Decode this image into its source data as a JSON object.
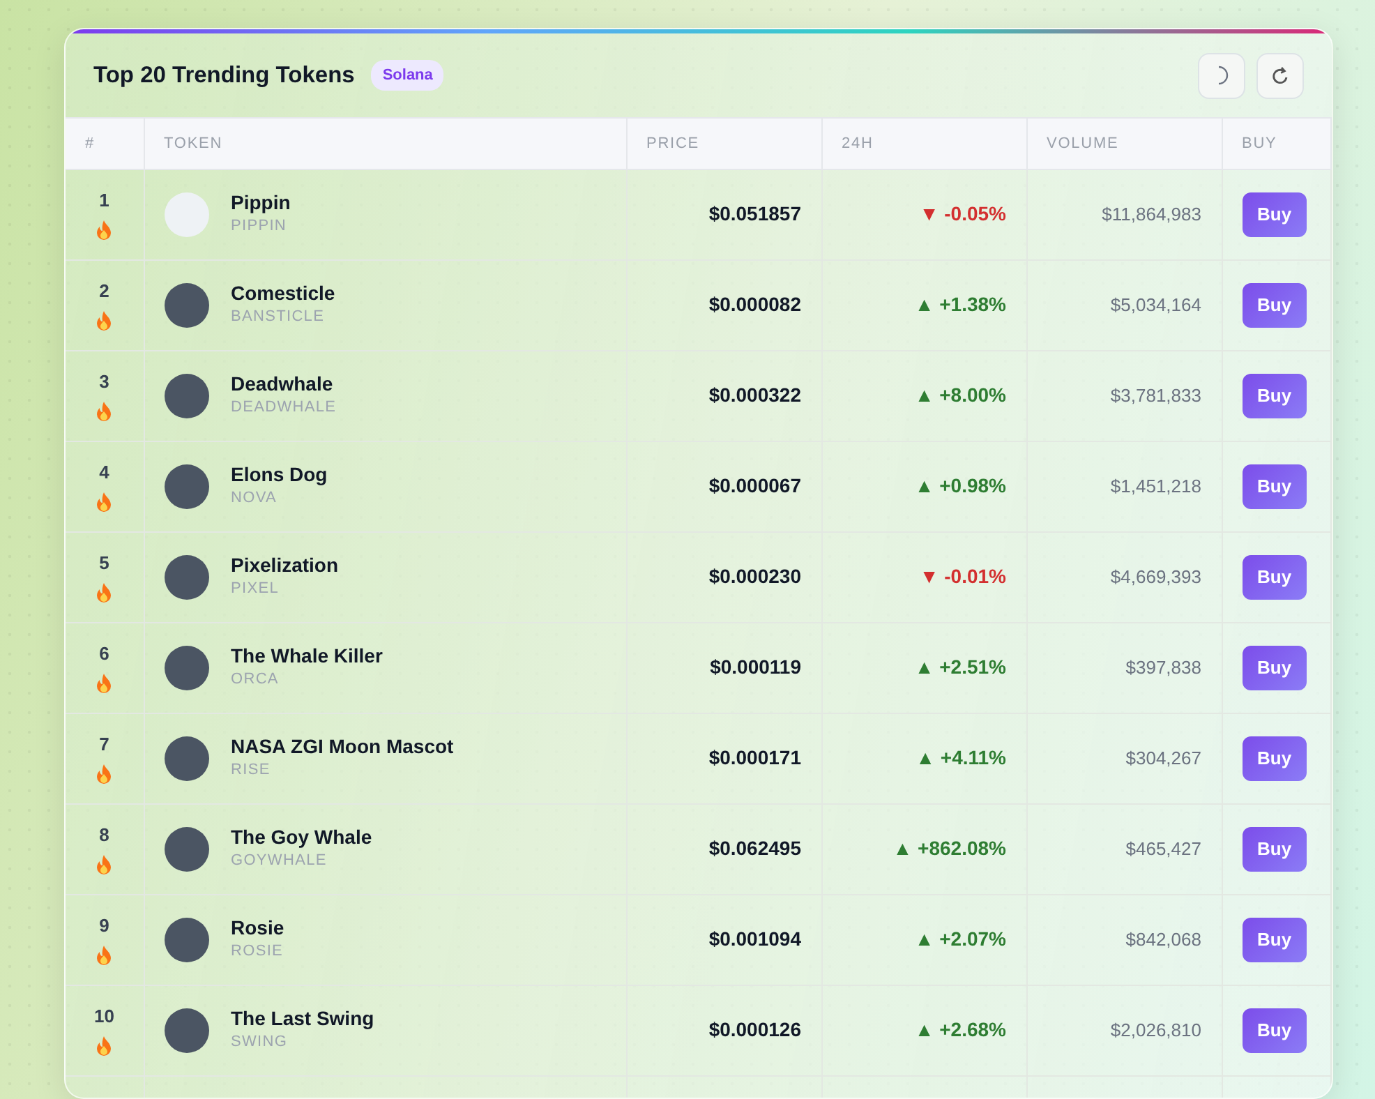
{
  "header": {
    "title": "Top 20 Trending Tokens",
    "chain_badge": "Solana"
  },
  "table": {
    "columns": [
      "#",
      "TOKEN",
      "PRICE",
      "24H",
      "VOLUME",
      "BUY"
    ],
    "rows": [
      {
        "rank": "1",
        "name": "Pippin",
        "symbol": "PIPPIN",
        "price": "$0.051857",
        "change": "▼ -0.05%",
        "color": "#d32f2f",
        "volume": "$11,864,983",
        "button": "Buy"
      },
      {
        "rank": "2",
        "name": "Comesticle",
        "symbol": "BANSTICLE",
        "price": "$0.000082",
        "change": "▲ +1.38%",
        "color": "#2e7d32",
        "volume": "$5,034,164",
        "button": "Buy"
      },
      {
        "rank": "3",
        "name": "Deadwhale",
        "symbol": "DEADWHALE",
        "price": "$0.000322",
        "change": "▲ +8.00%",
        "color": "#2e7d32",
        "volume": "$3,781,833",
        "button": "Buy"
      },
      {
        "rank": "4",
        "name": "Elons Dog",
        "symbol": "NOVA",
        "price": "$0.000067",
        "change": "▲ +0.98%",
        "color": "#2e7d32",
        "volume": "$1,451,218",
        "button": "Buy"
      },
      {
        "rank": "5",
        "name": "Pixelization",
        "symbol": "PIXEL",
        "price": "$0.000230",
        "change": "▼ -0.01%",
        "color": "#d32f2f",
        "volume": "$4,669,393",
        "button": "Buy"
      },
      {
        "rank": "6",
        "name": "The Whale Killer",
        "symbol": "ORCA",
        "price": "$0.000119",
        "change": "▲ +2.51%",
        "color": "#2e7d32",
        "volume": "$397,838",
        "button": "Buy"
      },
      {
        "rank": "7",
        "name": "NASA ZGI Moon Mascot",
        "symbol": "RISE",
        "price": "$0.000171",
        "change": "▲ +4.11%",
        "color": "#2e7d32",
        "volume": "$304,267",
        "button": "Buy"
      },
      {
        "rank": "8",
        "name": "The Goy Whale",
        "symbol": "GOYWHALE",
        "price": "$0.062495",
        "change": "▲ +862.08%",
        "color": "#2e7d32",
        "volume": "$465,427",
        "button": "Buy"
      },
      {
        "rank": "9",
        "name": "Rosie",
        "symbol": "ROSIE",
        "price": "$0.001094",
        "change": "▲ +2.07%",
        "color": "#2e7d32",
        "volume": "$842,068",
        "button": "Buy"
      },
      {
        "rank": "10",
        "name": "The Last Swing",
        "symbol": "SWING",
        "price": "$0.000126",
        "change": "▲ +2.68%",
        "color": "#2e7d32",
        "volume": "$2,026,810",
        "button": "Buy"
      }
    ]
  }
}
